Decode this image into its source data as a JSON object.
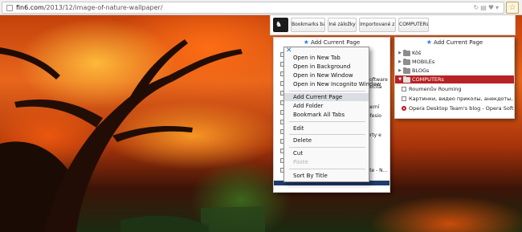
{
  "address_bar": {
    "url_host": "fin6.com",
    "url_path": "/2013/12/image-of-nature-wallpaper/",
    "icons": [
      "page-icon",
      "refresh-icon",
      "speed-dial-icon",
      "heart-icon",
      "dropdown-icon"
    ],
    "bookmark_star_icon": "star-icon",
    "bookmark_star_glyph": "☆"
  },
  "bookmark_bar": {
    "buttons": [
      "Bookmarks bar",
      "Iné záložky",
      "Importované z...",
      "COMPUTERs"
    ]
  },
  "left_pane": {
    "header": "Add Current Page",
    "peek_texts": [
      "software",
      "počíta",
      "herní",
      "ofesio",
      "urty e",
      "ste - N..."
    ]
  },
  "right_pane": {
    "header": "Add Current Page",
    "folders": [
      {
        "label": "Kôš",
        "selected": false
      },
      {
        "label": "MOBILEs",
        "selected": false
      },
      {
        "label": "BLOGs",
        "selected": false
      },
      {
        "label": "COMPUTERs",
        "selected": true
      }
    ],
    "items": [
      {
        "label": "Roumenův Rouming",
        "icon": "page-icon"
      },
      {
        "label": "Картинки, видео приколы, анекдоты, с...",
        "icon": "page-icon"
      },
      {
        "label": "Opera Desktop Team's blog - Opera Soft...",
        "icon": "opera-icon"
      }
    ]
  },
  "context_menu": {
    "close_icon": "x-icon",
    "groups": [
      [
        "Open in New Tab",
        "Open in Background",
        "Open in New Window",
        "Open in New Incognito Window"
      ],
      [
        "Add Current Page",
        "Add Folder",
        "Bookmark All Tabs"
      ],
      [
        "Edit",
        "Delete"
      ],
      [
        "Cut",
        "Paste"
      ],
      [
        "Sort By Title"
      ]
    ],
    "highlighted": "Add Current Page",
    "disabled": [
      "Paste"
    ]
  },
  "colors": {
    "selected_row": "#b62325",
    "accent_star": "#d6a200",
    "header_icon": "#2d7fd6"
  }
}
